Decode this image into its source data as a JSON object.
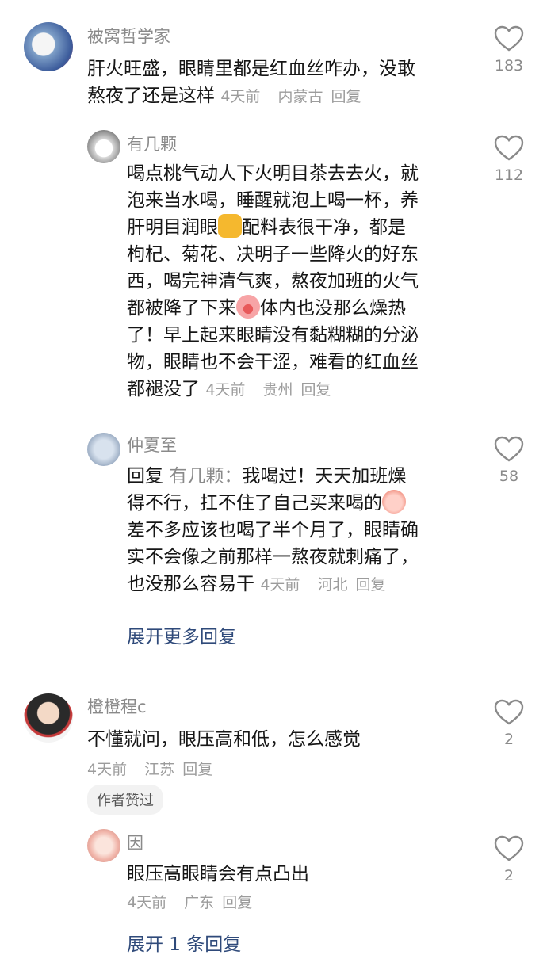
{
  "comments": [
    {
      "username": "被窝哲学家",
      "text_line1": "肝火旺盛，眼睛里都是红血丝咋办，没敢",
      "text_line2": "熬夜了还是这样",
      "time": "4天前",
      "location": "内蒙古",
      "reply": "回复",
      "likes": "183"
    },
    {
      "username": "有几颗",
      "lines": [
        "喝点桃气动人下火明目茶去去火，就",
        "泡来当水喝，睡醒就泡上喝一杯，养",
        "肝明目润眼",
        "配料表很干净，都是",
        "枸杞、菊花、决明子一些降火的好东",
        "西，喝完神清气爽，熬夜加班的火气",
        "都被降了下来",
        "体内也没那么燥热",
        "了！早上起来眼睛没有黏糊糊的分泌",
        "物，眼睛也不会干涩，难看的红血丝",
        "都褪没了"
      ],
      "time": "4天前",
      "location": "贵州",
      "reply": "回复",
      "likes": "112"
    },
    {
      "username": "仲夏至",
      "reply_prefix": "回复",
      "reply_to": "有几颗：",
      "lines": [
        "我喝过！天天加班燥",
        "得不行，扛不住了自己买来喝的",
        "差不多应该也喝了半个月了，眼睛确",
        "实不会像之前那样一熬夜就刺痛了，",
        "也没那么容易干"
      ],
      "time": "4天前",
      "location": "河北",
      "reply": "回复",
      "likes": "58"
    },
    {
      "username": "橙橙程c",
      "text": "不懂就问，眼压高和低，怎么感觉",
      "time": "4天前",
      "location": "江苏",
      "reply": "回复",
      "badge": "作者赞过",
      "likes": "2"
    },
    {
      "username": "因",
      "text": "眼压高眼睛会有点凸出",
      "time": "4天前",
      "location": "广东",
      "reply": "回复",
      "likes": "2"
    }
  ],
  "expand_more": "展开更多回复",
  "expand_one": "展开 1 条回复",
  "icons": {
    "like": "heart-outline-icon",
    "emoji_thumb": "thumbs-up-emoji",
    "emoji_pig": "pig-face-emoji",
    "emoji_cry": "crying-face-emoji"
  },
  "colors": {
    "text": "#161616",
    "meta": "#9c9c9c",
    "link": "#2f4a7a"
  }
}
